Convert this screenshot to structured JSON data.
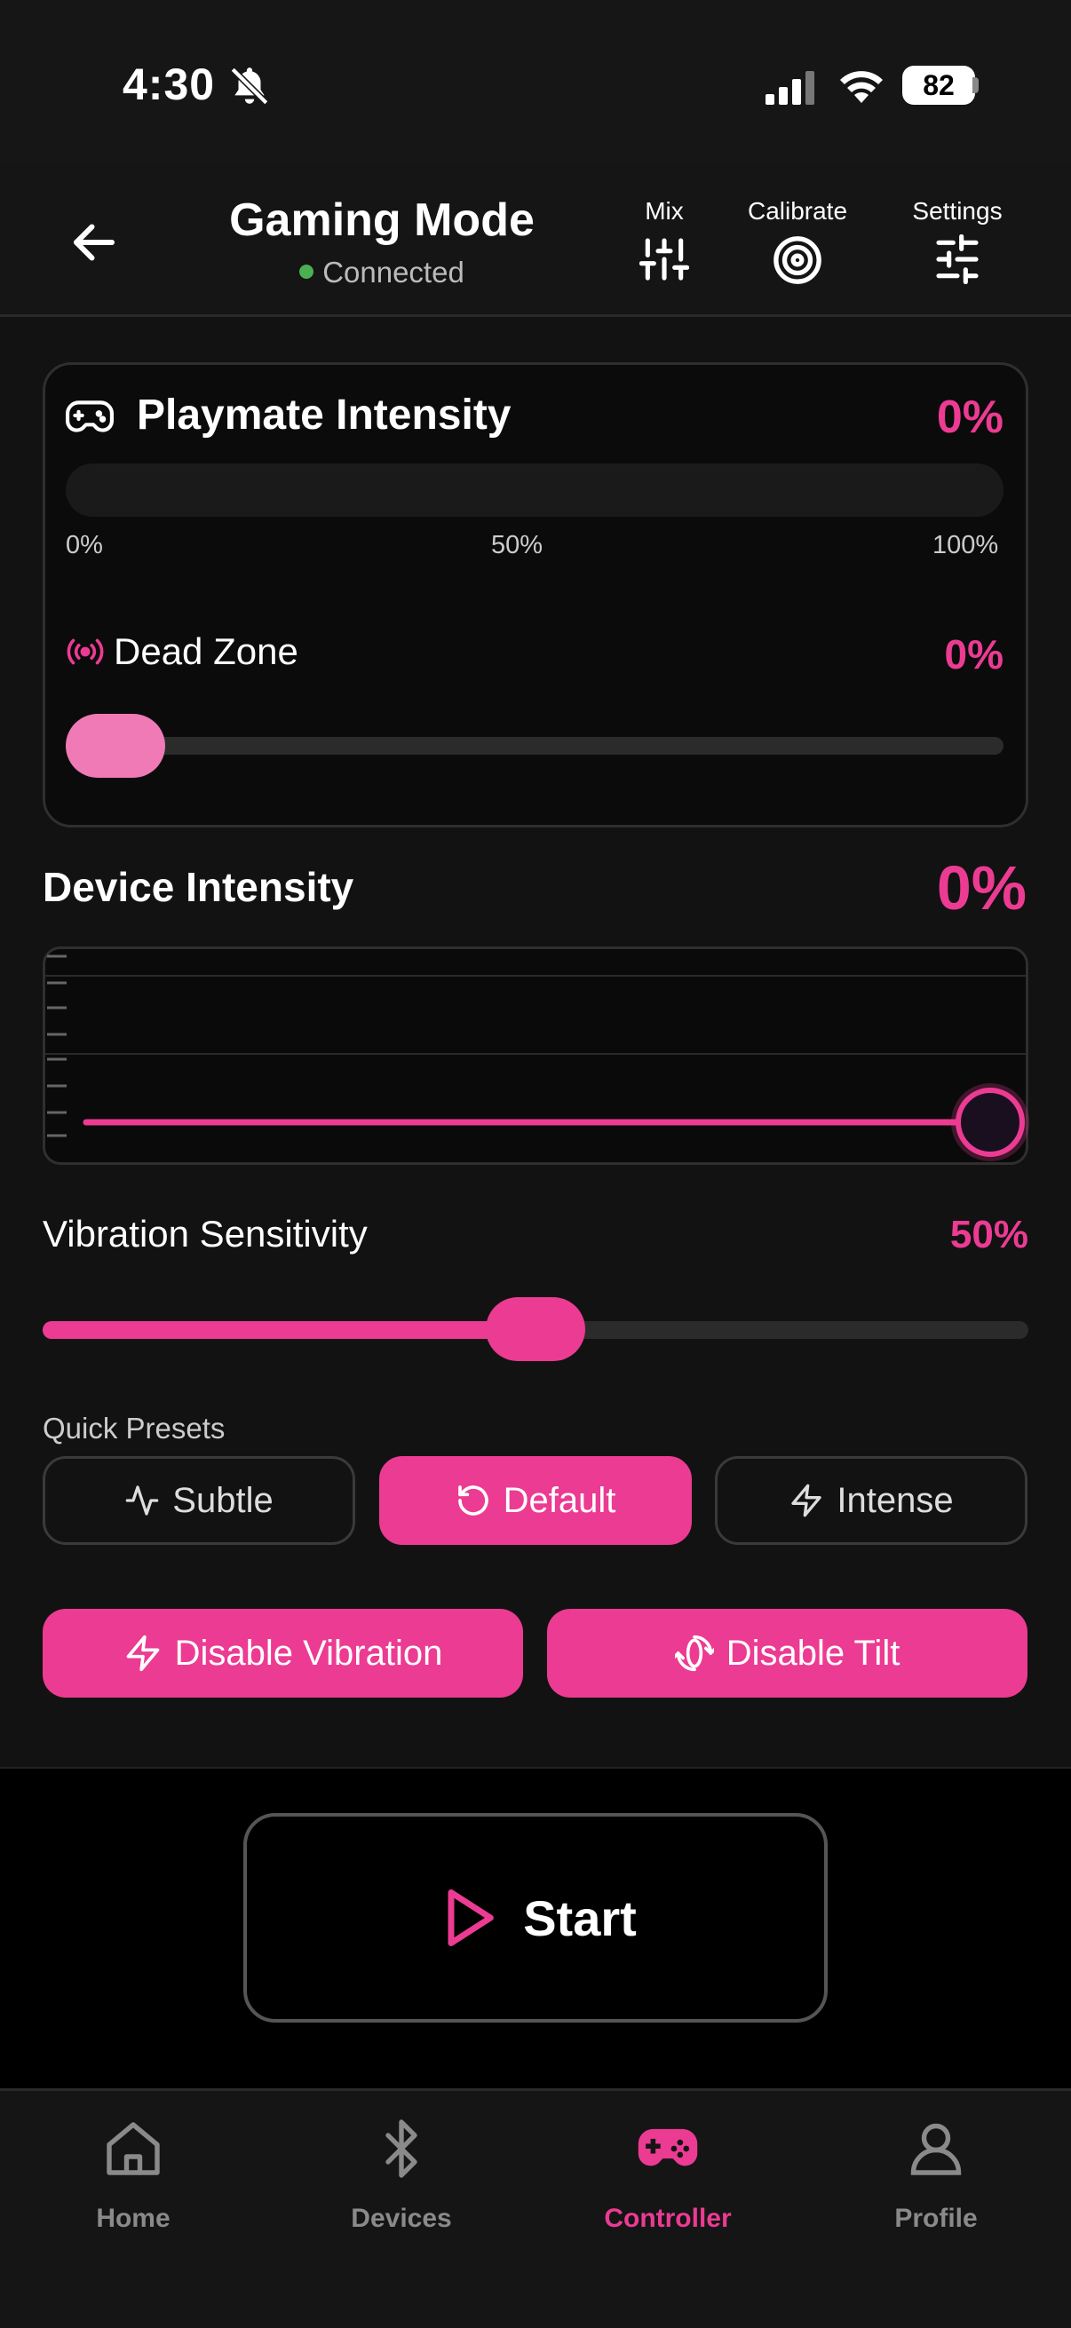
{
  "status_bar": {
    "time": "4:30",
    "battery": "82"
  },
  "header": {
    "title": "Gaming Mode",
    "connection": "Connected",
    "buttons": {
      "mix": "Mix",
      "calibrate": "Calibrate",
      "settings": "Settings"
    }
  },
  "playmate": {
    "title": "Playmate Intensity",
    "value_label": "0%",
    "level": 0,
    "ticks": {
      "min": "0%",
      "mid": "50%",
      "max": "100%"
    }
  },
  "dead_zone": {
    "title": "Dead Zone",
    "value_label": "0%",
    "level": 0
  },
  "device_intensity": {
    "title": "Device Intensity",
    "value_label": "0%",
    "level": 0
  },
  "vibration_sensitivity": {
    "title": "Vibration Sensitivity",
    "value_label": "50%",
    "level": 0.5
  },
  "presets": {
    "title": "Quick Presets",
    "items": [
      {
        "label": "Subtle",
        "icon": "activity-icon",
        "active": false
      },
      {
        "label": "Default",
        "icon": "rotate-ccw-icon",
        "active": true
      },
      {
        "label": "Intense",
        "icon": "zap-icon",
        "active": false
      }
    ]
  },
  "actions": {
    "disable_vibration": "Disable Vibration",
    "disable_tilt": "Disable Tilt"
  },
  "start_label": "Start",
  "tabs": [
    {
      "label": "Home",
      "icon": "home-icon",
      "active": false
    },
    {
      "label": "Devices",
      "icon": "bluetooth-icon",
      "active": false
    },
    {
      "label": "Controller",
      "icon": "gamepad-icon",
      "active": true
    },
    {
      "label": "Profile",
      "icon": "user-icon",
      "active": false
    }
  ],
  "colors": {
    "accent": "#ec3b92",
    "accent_light": "#f07ab5",
    "connected": "#4caf50",
    "background": "#121212"
  }
}
